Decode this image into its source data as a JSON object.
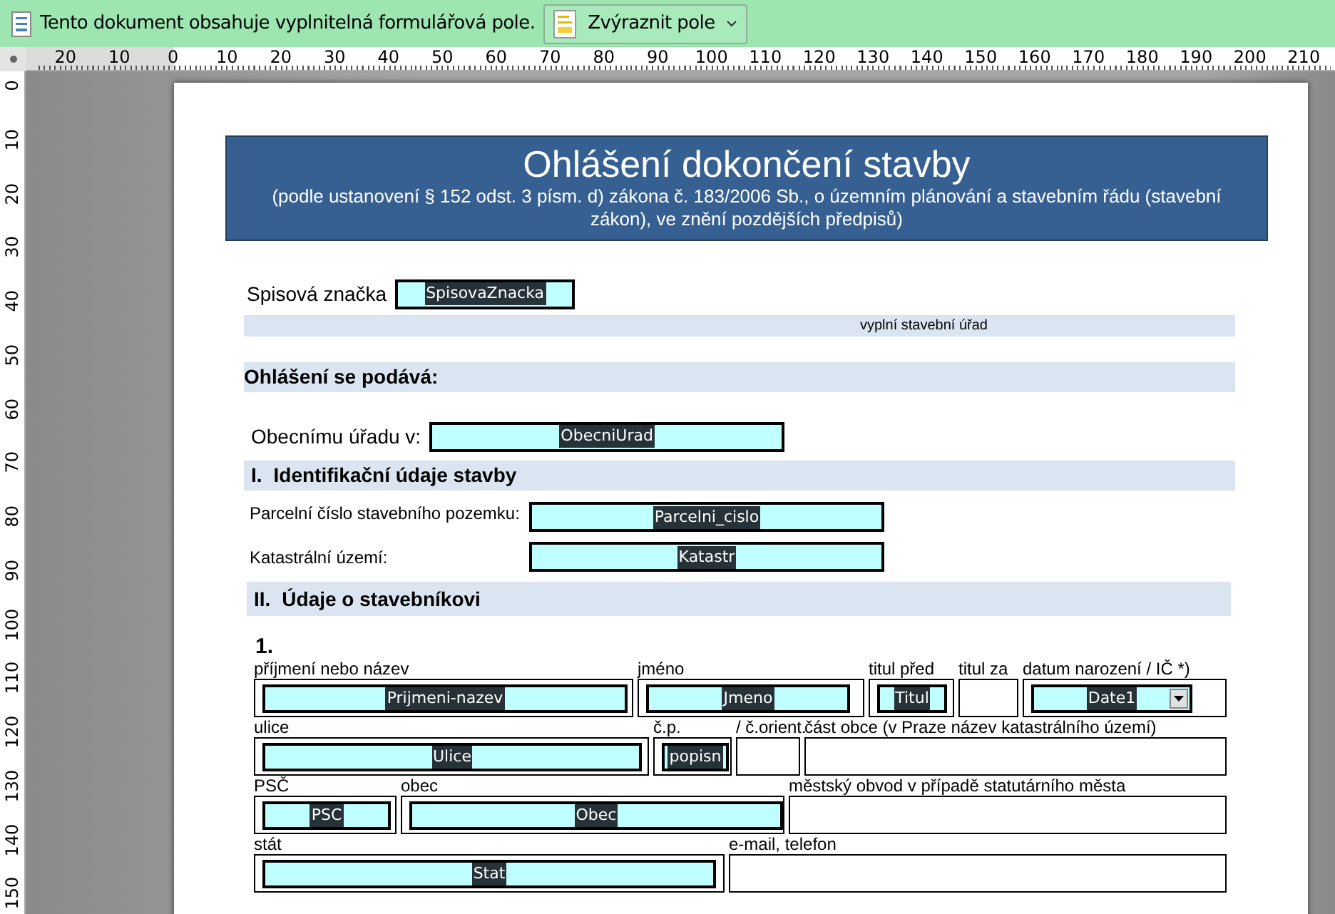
{
  "infobar": {
    "message": "Tento dokument obsahuje vyplnitelná formulářová pole.",
    "button": "Zvýraznit pole"
  },
  "ruler": {
    "horizontal": [
      "20",
      "10",
      "0",
      "10",
      "20",
      "30",
      "40",
      "50",
      "60",
      "70",
      "80",
      "90",
      "100",
      "110",
      "120",
      "130",
      "140",
      "150",
      "160",
      "170",
      "180",
      "190",
      "200",
      "210"
    ],
    "vertical": [
      "0",
      "10",
      "20",
      "30",
      "40",
      "50",
      "60",
      "70",
      "80",
      "90",
      "100",
      "110",
      "120",
      "130",
      "140",
      "150"
    ]
  },
  "header": {
    "title": "Ohlášení dokončení stavby",
    "subtitle": "(podle ustanovení § 152 odst. 3 písm. d) zákona č. 183/2006 Sb., o územním plánování a stavebním řádu (stavební zákon), ve znění pozdějších předpisů)"
  },
  "case_number": {
    "label": "Spisová značka",
    "field": {
      "name": "SpisovaZnacka",
      "kind": "text"
    }
  },
  "office_note": "vyplní stavební úřad",
  "submitted_to": {
    "heading": "Ohlášení se podává:",
    "label": "Obecnímu úřadu v:",
    "field": {
      "name": "ObecniUrad",
      "kind": "text"
    }
  },
  "section_1": {
    "number": "I.",
    "title": "Identifikační údaje stavby",
    "rows": [
      {
        "label": "Parcelní číslo stavebního pozemku:",
        "field": {
          "name": "Parcelni_cislo",
          "kind": "text"
        }
      },
      {
        "label": "Katastrální území:",
        "field": {
          "name": "Katastr",
          "kind": "text"
        }
      }
    ]
  },
  "section_2": {
    "number": "II.",
    "title": "Údaje o stavebníkovi",
    "person": "1.",
    "rows": [
      [
        {
          "label": "příjmení nebo název",
          "field": {
            "name": "Prijmeni-nazev",
            "kind": "text"
          }
        },
        {
          "label": "jméno",
          "field": {
            "name": "Jmeno",
            "kind": "text"
          }
        },
        {
          "label": "titul před",
          "field": {
            "name": "Titul",
            "kind": "text"
          }
        },
        {
          "label": "titul za"
        },
        {
          "label": "datum narození / IČ *)",
          "field": {
            "name": "Date1",
            "kind": "dropdown"
          }
        }
      ],
      [
        {
          "label": "ulice",
          "field": {
            "name": "Ulice",
            "kind": "text"
          }
        },
        {
          "label": "č.p.",
          "field": {
            "name": "popisn",
            "kind": "text"
          }
        },
        {
          "label": "/ č.orient."
        },
        {
          "label": "část obce (v Praze název katastrálního území)"
        }
      ],
      [
        {
          "label": "PSČ",
          "field": {
            "name": "PSC",
            "kind": "text"
          }
        },
        {
          "label": "obec",
          "field": {
            "name": "Obec",
            "kind": "text"
          }
        },
        {
          "label": "městský obvod v případě statutárního města"
        }
      ],
      [
        {
          "label": "stát",
          "field": {
            "name": "Stat",
            "kind": "text"
          }
        },
        {
          "label": "e-mail, telefon"
        }
      ]
    ]
  }
}
